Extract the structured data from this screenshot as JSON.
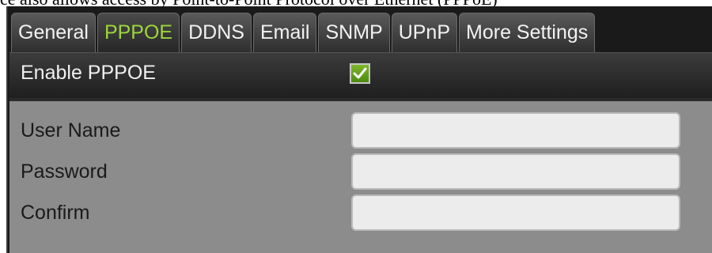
{
  "document": {
    "text": "ce also allows access by Point-to-Point Protocol over Ethernet (PPPoE)"
  },
  "tabs": [
    {
      "label": "General",
      "active": false
    },
    {
      "label": "PPPOE",
      "active": true
    },
    {
      "label": "DDNS",
      "active": false
    },
    {
      "label": "Email",
      "active": false
    },
    {
      "label": "SNMP",
      "active": false
    },
    {
      "label": "UPnP",
      "active": false
    },
    {
      "label": "More Settings",
      "active": false
    }
  ],
  "enable": {
    "label": "Enable PPPOE",
    "checked": true
  },
  "form": {
    "user_name": {
      "label": "User Name",
      "value": ""
    },
    "password": {
      "label": "Password",
      "value": ""
    },
    "confirm": {
      "label": "Confirm",
      "value": ""
    }
  },
  "colors": {
    "active_tab_text": "#9ed63a",
    "tab_text": "#f2f2f2",
    "checkbox_fill": "#6aa51f",
    "form_background": "#8c8c8c",
    "field_background": "#ececec"
  },
  "icons": {
    "checkbox": "check-icon"
  }
}
